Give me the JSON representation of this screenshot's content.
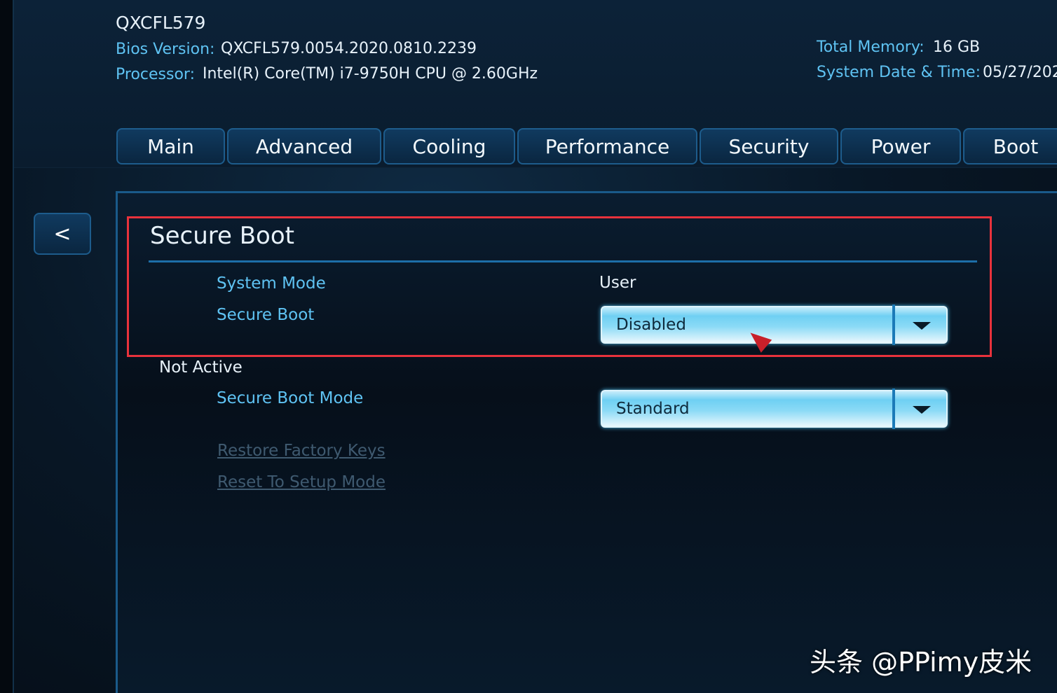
{
  "header": {
    "model": "QXCFL579",
    "bios_label": "Bios Version:",
    "bios_value": "QXCFL579.0054.2020.0810.2239",
    "processor_label": "Processor:",
    "processor_value": "Intel(R) Core(TM) i7-9750H CPU @ 2.60GHz",
    "memory_label": "Total Memory:",
    "memory_value": "16 GB",
    "datetime_label": "System Date & Time:",
    "datetime_value": "05/27/202"
  },
  "tabs": [
    {
      "label": "Main"
    },
    {
      "label": "Advanced"
    },
    {
      "label": "Cooling"
    },
    {
      "label": "Performance"
    },
    {
      "label": "Security"
    },
    {
      "label": "Power"
    },
    {
      "label": "Boot"
    }
  ],
  "back_label": "<",
  "section": {
    "title": "Secure Boot",
    "system_mode_label": "System Mode",
    "system_mode_value": "User",
    "secure_boot_label": "Secure Boot",
    "secure_boot_value": "Disabled",
    "status": "Not Active",
    "secure_boot_mode_label": "Secure Boot Mode",
    "secure_boot_mode_value": "Standard",
    "restore_keys": "Restore Factory Keys",
    "reset_setup": "Reset To Setup Mode"
  },
  "watermark": "头条 @PPimy皮米",
  "colors": {
    "highlight": "#e8323c",
    "label": "#5fc3f3",
    "accent": "#1d6ea8"
  }
}
